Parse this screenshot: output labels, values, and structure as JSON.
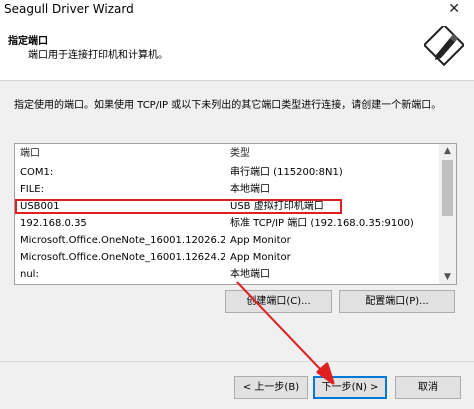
{
  "window": {
    "title": "Seagull Driver Wizard",
    "close_glyph": "✕"
  },
  "header": {
    "title": "指定端口",
    "subtitle": "端口用于连接打印机和计算机。",
    "icon": "wizard-pen-icon"
  },
  "instruction": "指定使用的端口。如果使用 TCP/IP 或以下未列出的其它端口类型进行连接，请创建一个新端口。",
  "port_list": {
    "columns": [
      "端口",
      "类型"
    ],
    "rows": [
      {
        "port": "COM1:",
        "type": "串行端口 (115200:8N1)"
      },
      {
        "port": "FILE:",
        "type": "本地端口"
      },
      {
        "port": "USB001",
        "type": "USB 虚拟打印机端口"
      },
      {
        "port": "192.168.0.35",
        "type": "标准 TCP/IP 端口 (192.168.0.35:9100)"
      },
      {
        "port": "Microsoft.Office.OneNote_16001.12026.2...",
        "type": "App Monitor"
      },
      {
        "port": "Microsoft.Office.OneNote_16001.12624.2...",
        "type": "App Monitor"
      },
      {
        "port": "nul:",
        "type": "本地端口"
      }
    ],
    "highlighted_port": "USB001",
    "highlight_color": "#e02020"
  },
  "buttons": {
    "create_port": "创建端口(C)...",
    "configure_port": "配置端口(P)...",
    "back": "< 上一步(B)",
    "next": "下一步(N) >",
    "cancel": "取消"
  },
  "annotation_color": "#e02020"
}
